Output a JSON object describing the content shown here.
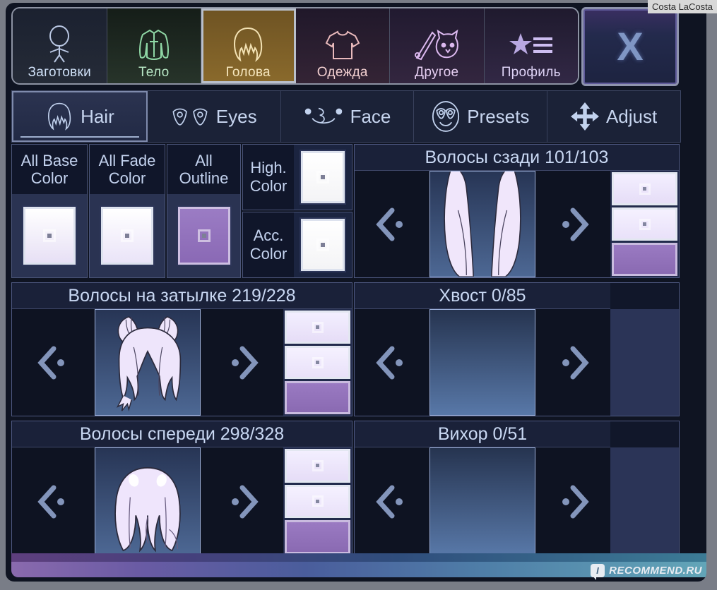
{
  "watermarks": {
    "top_right": "Costa LaCosta",
    "bottom_right": "RECOMMEND.RU",
    "bottom_badge": "I"
  },
  "close_button": {
    "label": "X",
    "name": "close-icon"
  },
  "categories": [
    {
      "label": "Заготовки",
      "icon": "chibi-body-icon",
      "selected": false
    },
    {
      "label": "Тело",
      "icon": "jacket-icon",
      "selected": false
    },
    {
      "label": "Голова",
      "icon": "hair-head-icon",
      "selected": true
    },
    {
      "label": "Одежда",
      "icon": "tshirt-icon",
      "selected": false
    },
    {
      "label": "Другое",
      "icon": "sword-cat-icon",
      "selected": false
    },
    {
      "label": "Профиль",
      "icon": "star-list-icon",
      "selected": false
    }
  ],
  "subtabs": [
    {
      "label": "Hair",
      "icon": "hair-icon",
      "active": true
    },
    {
      "label": "Eyes",
      "icon": "eyes-icon",
      "active": false
    },
    {
      "label": "Face",
      "icon": "face-icon",
      "active": false
    },
    {
      "label": "Presets",
      "icon": "presets-icon",
      "active": false
    },
    {
      "label": "Adjust",
      "icon": "adjust-icon",
      "active": false
    }
  ],
  "color_controls": [
    {
      "label_line1": "All Base",
      "label_line2": "Color",
      "swatch_color": "#e9e2f6"
    },
    {
      "label_line1": "All Fade",
      "label_line2": "Color",
      "swatch_color": "#ebe5f8"
    },
    {
      "label_line1": "All",
      "label_line2": "Outline",
      "swatch_color": "#8f6fba"
    }
  ],
  "stacked_color_controls": [
    {
      "label_line1": "High.",
      "label_line2": "Color",
      "swatch_color": "#ffffff"
    },
    {
      "label_line1": "Acc.",
      "label_line2": "Color",
      "swatch_color": "#ffffff"
    }
  ],
  "items": [
    {
      "title": "Волосы сзади 101/103",
      "prev_icon": "previous-arrow-icon",
      "next_icon": "next-arrow-icon",
      "has_preview": true,
      "preview_kind": "back-hair",
      "swatches": [
        "#e9e2f6",
        "#ece6f8",
        "#8f6fba"
      ]
    },
    {
      "title": "Хвост 0/85",
      "prev_icon": "previous-arrow-icon",
      "next_icon": "next-arrow-icon",
      "has_preview": false,
      "preview_kind": "empty",
      "swatches": []
    },
    {
      "title": "Волосы на затылке 219/228",
      "prev_icon": "previous-arrow-icon",
      "next_icon": "next-arrow-icon",
      "has_preview": true,
      "preview_kind": "back-head-hair",
      "swatches": [
        "#e9e2f6",
        "#ece6f8",
        "#8f6fba"
      ]
    },
    {
      "title": "Вихор 0/51",
      "prev_icon": "previous-arrow-icon",
      "next_icon": "next-arrow-icon",
      "has_preview": false,
      "preview_kind": "empty",
      "swatches": []
    },
    {
      "title": "Волосы спереди 298/328",
      "prev_icon": "previous-arrow-icon",
      "next_icon": "next-arrow-icon",
      "has_preview": true,
      "preview_kind": "front-hair",
      "swatches": [
        "#e9e2f6",
        "#ece6f8",
        "#8f6fba"
      ]
    }
  ],
  "theme": {
    "frame": "#797d87",
    "screen_bg": "#0f1422",
    "panel_bg": "#11172a",
    "panel_border": "#4e5881",
    "text": "#c9d8f3",
    "selected_tab_bg": "#8a6a2c",
    "accent_purple": "#8f6fba",
    "bottom_gradient_from": "#8a6aae",
    "bottom_gradient_to": "#63a6b8"
  }
}
